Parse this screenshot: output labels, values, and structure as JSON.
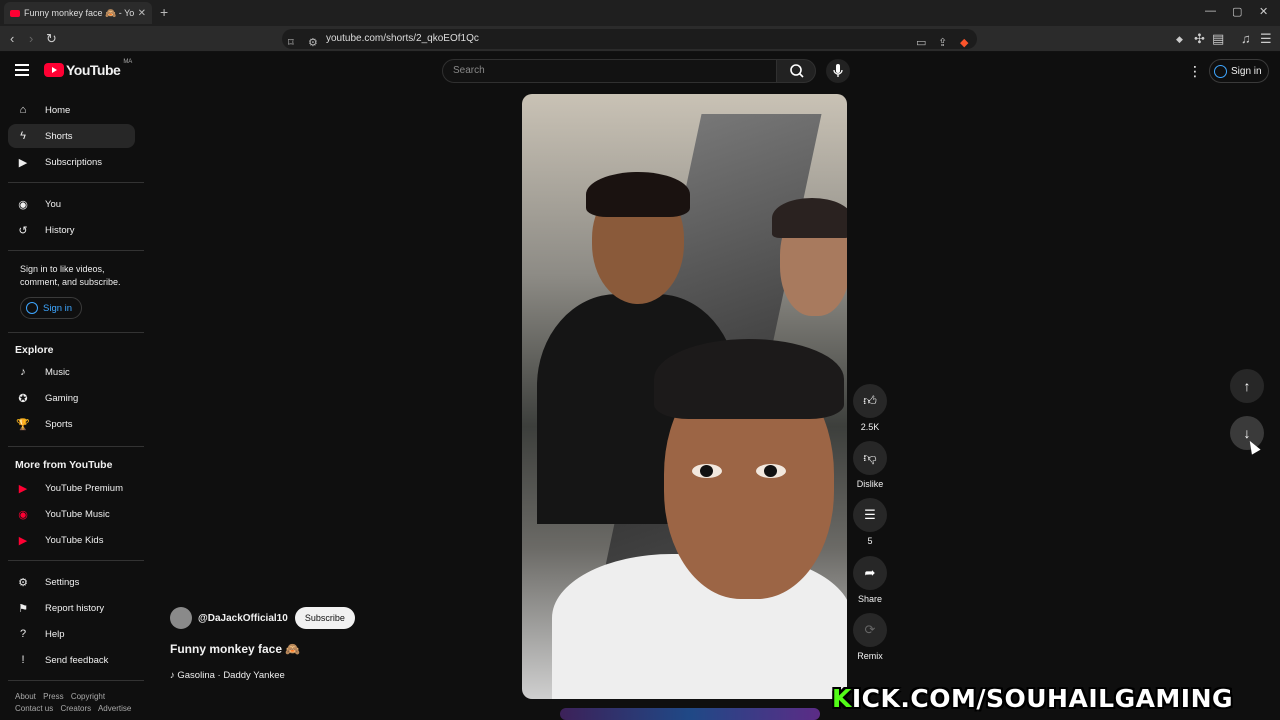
{
  "browser": {
    "tab_title": "Funny monkey face 🙈 - You",
    "new_tab": "+",
    "url": "youtube.com/shorts/2_qkoEOf1Qc"
  },
  "header": {
    "logo_text": "YouTube",
    "country_code": "MA",
    "search_placeholder": "Search",
    "signin_label": "Sign in"
  },
  "sidebar": {
    "main": [
      {
        "label": "Home",
        "icon": "home-icon"
      },
      {
        "label": "Shorts",
        "icon": "shorts-icon"
      },
      {
        "label": "Subscriptions",
        "icon": "subscriptions-icon"
      }
    ],
    "you": [
      {
        "label": "You",
        "icon": "you-icon"
      },
      {
        "label": "History",
        "icon": "history-icon"
      }
    ],
    "signin_note": "Sign in to like videos, comment, and subscribe.",
    "signin_button": "Sign in",
    "explore_heading": "Explore",
    "explore": [
      {
        "label": "Music",
        "icon": "music-icon"
      },
      {
        "label": "Gaming",
        "icon": "gaming-icon"
      },
      {
        "label": "Sports",
        "icon": "sports-icon"
      }
    ],
    "more_heading": "More from YouTube",
    "more": [
      {
        "label": "YouTube Premium",
        "icon": "youtube-premium-icon"
      },
      {
        "label": "YouTube Music",
        "icon": "youtube-music-icon"
      },
      {
        "label": "YouTube Kids",
        "icon": "youtube-kids-icon"
      }
    ],
    "settings": [
      {
        "label": "Settings",
        "icon": "gear-icon"
      },
      {
        "label": "Report history",
        "icon": "flag-icon"
      },
      {
        "label": "Help",
        "icon": "help-icon"
      },
      {
        "label": "Send feedback",
        "icon": "feedback-icon"
      }
    ],
    "footer_line1": [
      "About",
      "Press",
      "Copyright"
    ],
    "footer_line2": [
      "Contact us",
      "Creators",
      "Advertise"
    ]
  },
  "short": {
    "channel": "@DaJackOfficial10",
    "subscribe": "Subscribe",
    "title": "Funny monkey face 🙈",
    "music": "♪ Gasolina · Daddy Yankee"
  },
  "actions": {
    "likes": "2.5K",
    "dislike": "Dislike",
    "comments": "5",
    "share": "Share",
    "remix": "Remix"
  },
  "watermark": {
    "k": "K",
    "rest": "ICK.COM/SOUHAILGAMING"
  },
  "colors": {
    "brand_red": "#ff0033",
    "link_blue": "#3ea6ff",
    "kick_green": "#53fc18"
  }
}
